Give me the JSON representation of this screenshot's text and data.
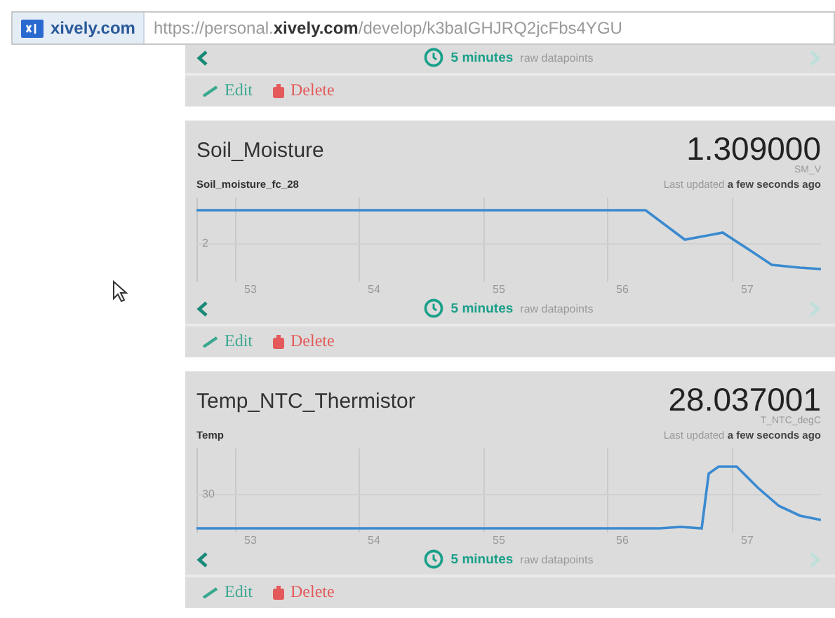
{
  "address_bar": {
    "site": "xively.com",
    "url": "https://personal.**xively.com**/develop/k3baIGHJRQ2jcFbs4YGU"
  },
  "cards": [
    {
      "kind": "partial",
      "range": "5 minutes",
      "range_note": "raw datapoints",
      "actions": [
        "Edit",
        "Delete"
      ]
    },
    {
      "kind": "full",
      "name": "Soil_Moisture",
      "value": "1.309000",
      "unit": "SM_V",
      "channel": "Soil_moisture_fc_28",
      "updated": "Last updated **a few seconds ago**",
      "y_label": "2",
      "x_labels": [
        "53",
        "54",
        "55",
        "56",
        "57"
      ],
      "range": "5 minutes",
      "range_note": "raw datapoints",
      "actions": [
        "Edit",
        "Delete"
      ]
    },
    {
      "kind": "full",
      "name": "Temp_NTC_Thermistor",
      "value": "28.037001",
      "unit": "T_NTC_degC",
      "channel": "Temp",
      "updated": "Last updated **a few seconds ago**",
      "y_label": "30",
      "x_labels": [
        "53",
        "54",
        "55",
        "56",
        "57"
      ],
      "range": "5 minutes",
      "range_note": "raw datapoints",
      "actions": [
        "Edit",
        "Delete"
      ]
    }
  ]
}
